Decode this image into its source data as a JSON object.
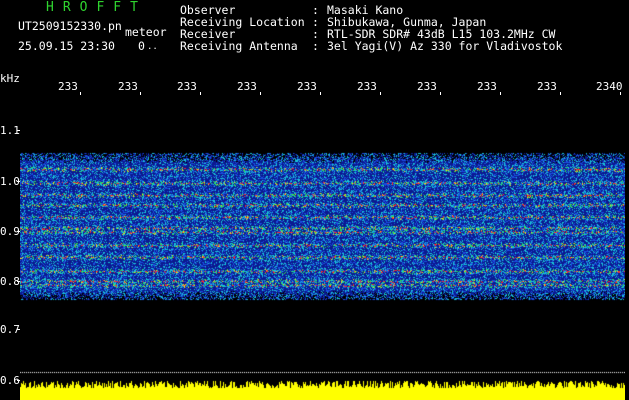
{
  "app": {
    "title": "HROFFT",
    "filename": "UT2509152330.pn",
    "mode": "meteor",
    "datetime": "25.09.15 23:30",
    "count": "0"
  },
  "header": {
    "rows": [
      {
        "label": "Observer",
        "value": "Masaki Kano"
      },
      {
        "label": "Receiving Location",
        "value": "Shibukawa, Gunma, Japan"
      },
      {
        "label": "Receiver",
        "value": "RTL-SDR SDR# 43dB L15 103.2MHz CW"
      },
      {
        "label": "Receiving Antenna",
        "value": "3el Yagi(V) Az 330 for Vladivostok"
      }
    ]
  },
  "axis": {
    "y_unit": "kHz",
    "y_ticks": [
      "1.1",
      "1.0",
      "0.9",
      "0.8",
      "0.7",
      "0.6"
    ],
    "x_ticks": [
      "233",
      "233",
      "233",
      "233",
      "233",
      "233",
      "233",
      "233",
      "233",
      "2340"
    ]
  },
  "colors": {
    "title_green": "#2fd42f",
    "noise_floor": "#ffff00",
    "band_low": "#0a1a8c",
    "band_mid": "#14c8c8",
    "band_high": "#ff2020"
  }
}
